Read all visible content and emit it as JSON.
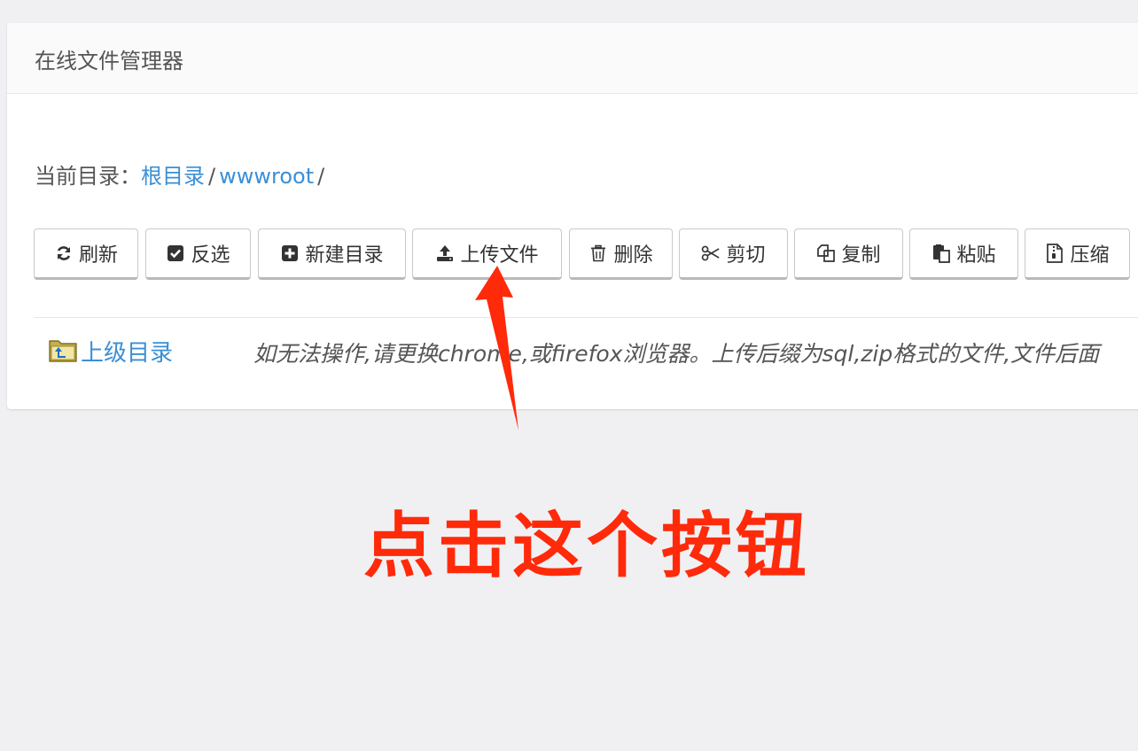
{
  "panel": {
    "title": "在线文件管理器"
  },
  "breadcrumb": {
    "prefix": "当前目录：",
    "items": [
      "根目录",
      "wwwroot"
    ],
    "separator": "/"
  },
  "toolbar": {
    "buttons": [
      {
        "label": "刷新",
        "icon": "refresh-icon"
      },
      {
        "label": "反选",
        "icon": "checkbox-checked-icon"
      },
      {
        "label": "新建目录",
        "icon": "plus-square-icon"
      },
      {
        "label": "上传文件",
        "icon": "upload-icon"
      },
      {
        "label": "删除",
        "icon": "trash-icon"
      },
      {
        "label": "剪切",
        "icon": "scissors-icon"
      },
      {
        "label": "复制",
        "icon": "copy-icon"
      },
      {
        "label": "粘贴",
        "icon": "paste-icon"
      },
      {
        "label": "压缩",
        "icon": "zip-file-icon"
      }
    ]
  },
  "file_list": {
    "parent_dir_label": "上级目录",
    "parent_dir_icon": "folder-up-icon",
    "notice": "如无法操作,请更换chrome,或firefox浏览器。上传后缀为sql,zip格式的文件,文件后面"
  },
  "annotation": {
    "text": "点击这个按钮",
    "color": "#ff2a0a"
  },
  "colors": {
    "link": "#3a8fd6",
    "background": "#f0f0f3"
  }
}
